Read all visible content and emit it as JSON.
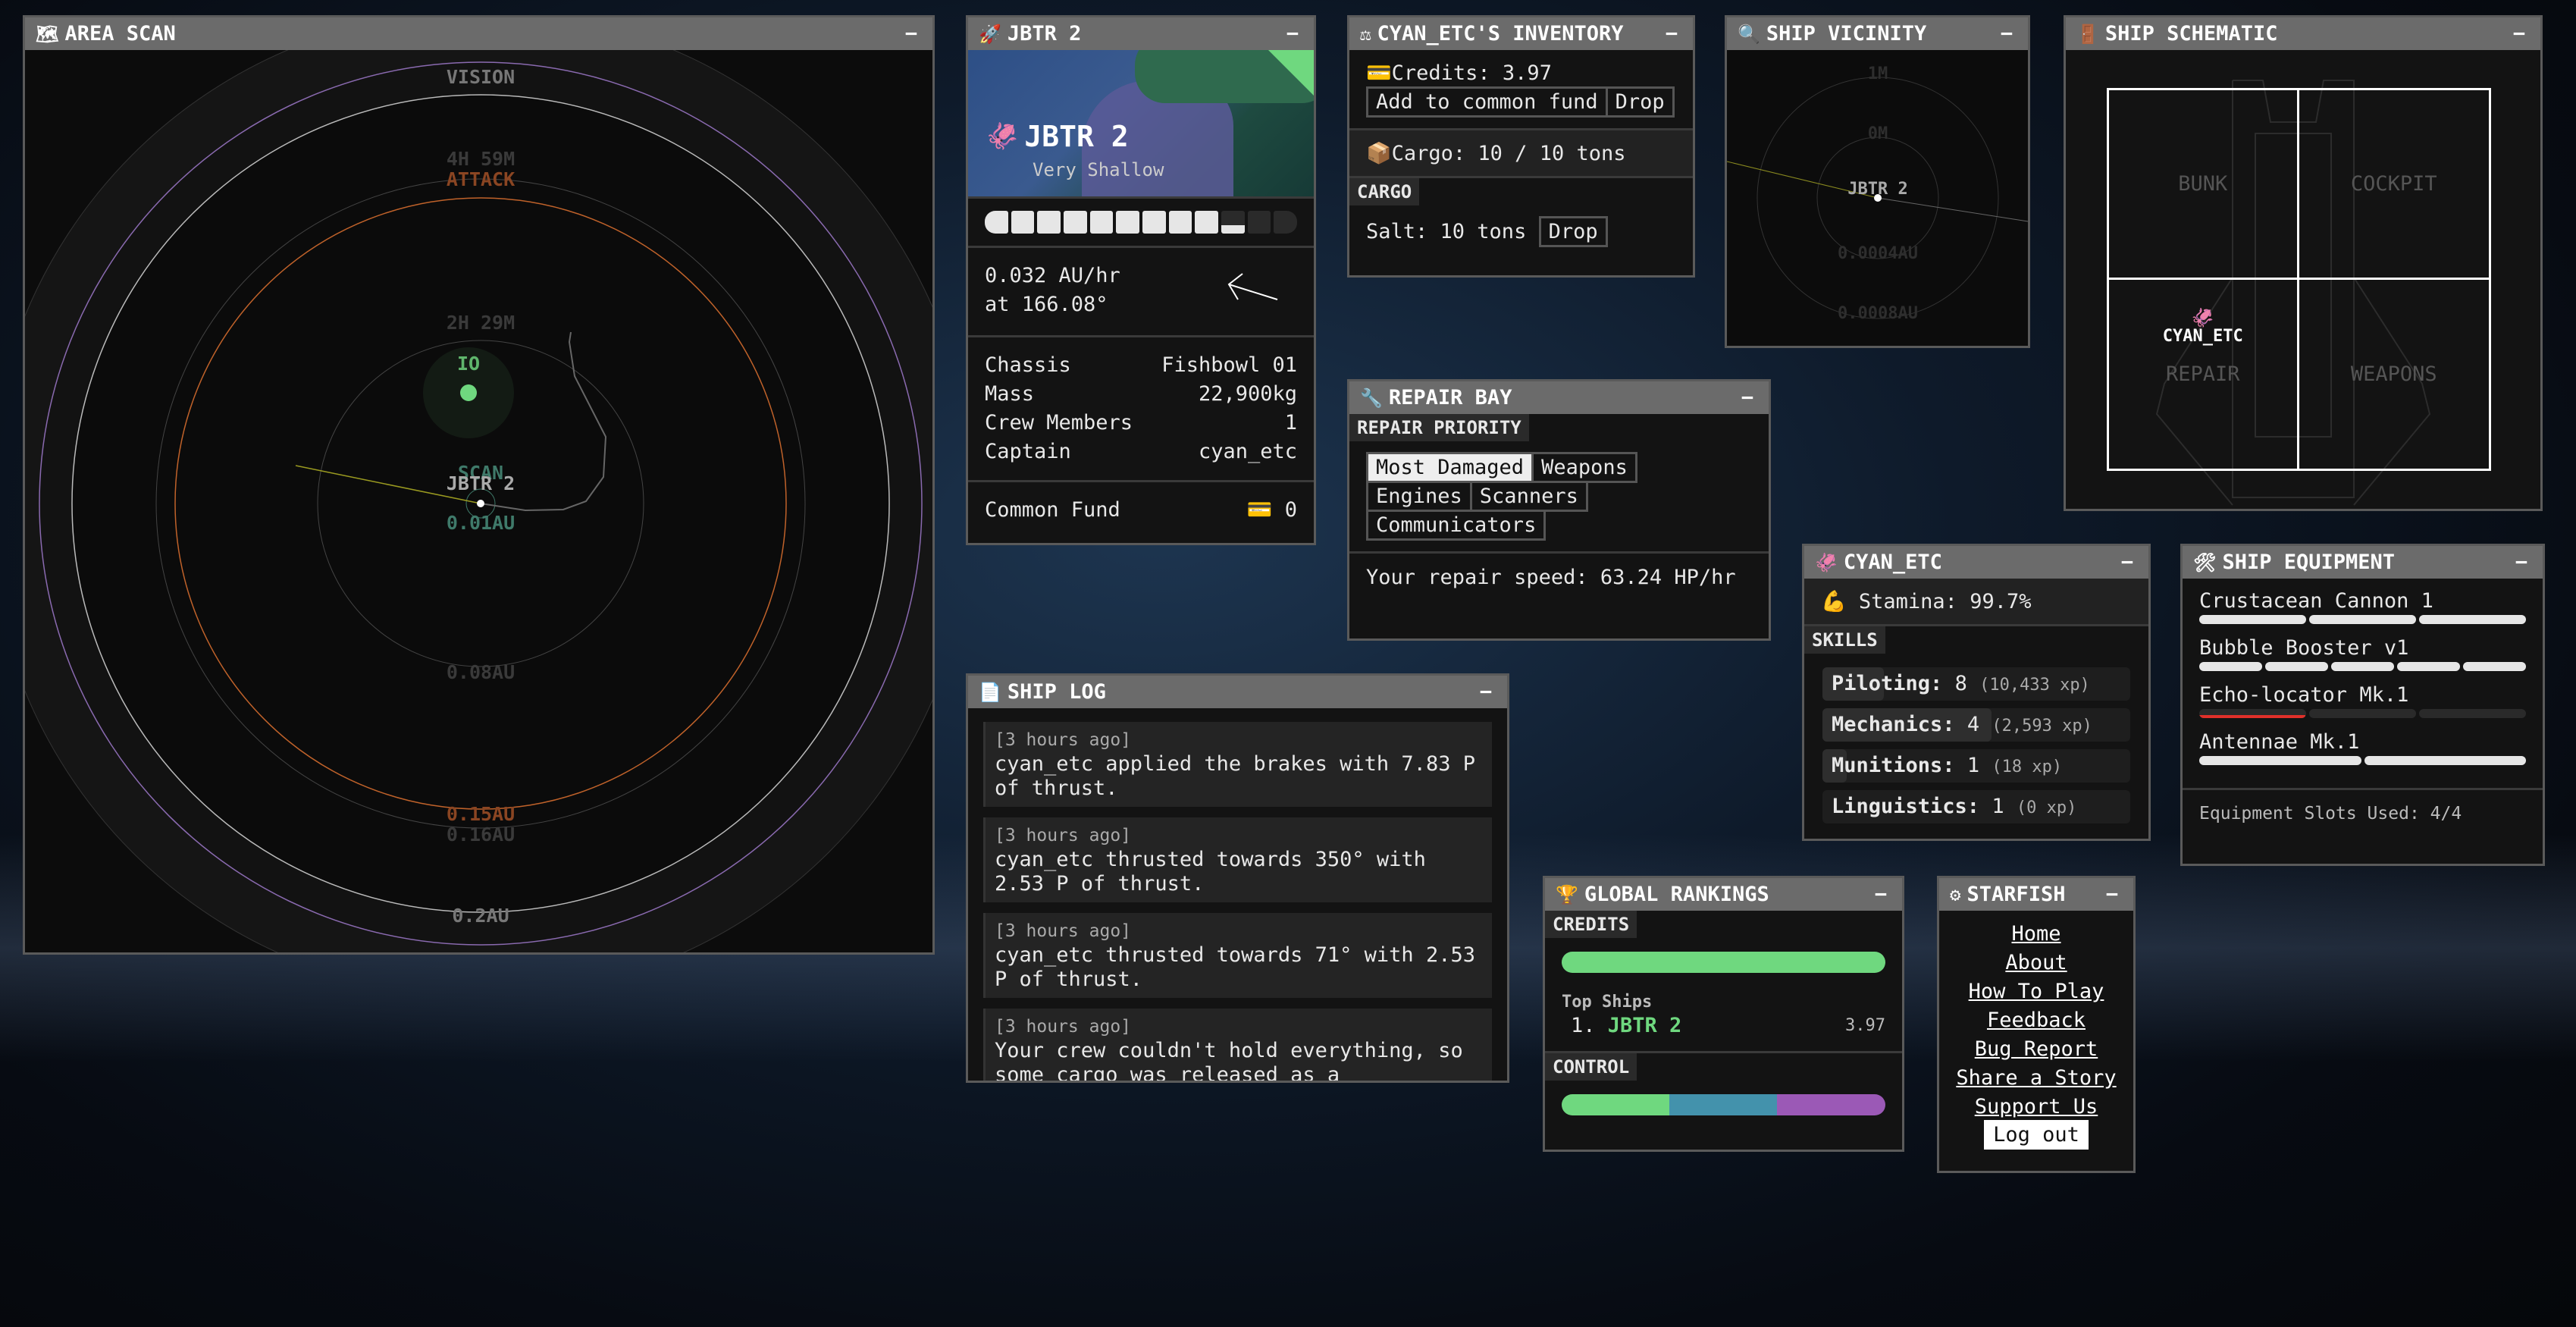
{
  "area_scan": {
    "title": "AREA SCAN",
    "icon": "map-icon",
    "labels": {
      "vision": "VISION",
      "eta_outer": "4H 59M",
      "attack": "ATTACK",
      "eta_inner": "2H 29M",
      "scan": "SCAN",
      "ship": "JBTR 2",
      "scan_range": "0.01AU",
      "r1": "0.08AU",
      "attack_range": "0.15AU",
      "r2": "0.16AU",
      "vision_range": "0.2AU",
      "planet": "IO"
    },
    "colors": {
      "attack": "#c0622a",
      "vision": "#cfcfcf",
      "planet": "#6fd87f",
      "scan": "#3f7a6a",
      "purple": "#8a6ab0"
    }
  },
  "ship": {
    "title": "JBTR 2",
    "icon": "rocket-icon",
    "name": "JBTR 2",
    "depth": "Very Shallow",
    "hull_fraction": 0.78,
    "hull_segments": 12,
    "speed": "0.032 AU/hr",
    "heading": "at 166.08°",
    "stats": [
      {
        "label": "Chassis",
        "value": "Fishbowl 01"
      },
      {
        "label": "Mass",
        "value": "22,900kg"
      },
      {
        "label": "Crew Members",
        "value": "1"
      },
      {
        "label": "Captain",
        "value": "cyan_etc"
      }
    ],
    "common_fund_label": "Common Fund",
    "common_fund": "0"
  },
  "inventory": {
    "title": "CYAN_ETC'S INVENTORY",
    "icon": "scale-icon",
    "credits": "Credits: 3.97",
    "add_fund": "Add to common fund",
    "drop": "Drop",
    "cargo": "Cargo: 10 / 10 tons",
    "cargo_header": "CARGO",
    "items": [
      {
        "label": "Salt: 10 tons",
        "drop": "Drop"
      }
    ]
  },
  "vicinity": {
    "title": "SHIP VICINITY",
    "icon": "magnifier-icon",
    "labels": {
      "a": "1M",
      "b": "0M",
      "ship": "JBTR 2",
      "c": "0.0004AU",
      "d": "0.0008AU"
    }
  },
  "schematic": {
    "title": "SHIP SCHEMATIC",
    "icon": "door-icon",
    "rooms": [
      "BUNK",
      "COCKPIT",
      "REPAIR",
      "WEAPONS"
    ],
    "crew": "CYAN_ETC"
  },
  "repair": {
    "title": "REPAIR BAY",
    "icon": "wrench-icon",
    "header": "REPAIR PRIORITY",
    "options": [
      "Most Damaged",
      "Weapons",
      "Engines",
      "Scanners",
      "Communicators"
    ],
    "selected": "Most Damaged",
    "speed": "Your repair speed: 63.24 HP/hr"
  },
  "log": {
    "title": "SHIP LOG",
    "icon": "document-icon",
    "entries": [
      {
        "time": "[3 hours ago]",
        "text": "cyan_etc applied the brakes with 7.83 P of thrust."
      },
      {
        "time": "[3 hours ago]",
        "text": "cyan_etc thrusted towards 350° with 2.53 P of thrust."
      },
      {
        "time": "[3 hours ago]",
        "text": "cyan_etc thrusted towards 71° with 2.53 P of thrust."
      },
      {
        "time": "[3 hours ago]",
        "text": "Your crew couldn't hold everything, so some cargo was released as a"
      }
    ]
  },
  "crew": {
    "title": "CYAN_ETC",
    "icon": "squid-icon",
    "stamina": "Stamina: 99.7%",
    "skills_header": "SKILLS",
    "skills": [
      {
        "name": "Piloting:",
        "level": "8",
        "xp": "(10,433 xp)",
        "progress": 0.2
      },
      {
        "name": "Mechanics:",
        "level": "4",
        "xp": "(2,593 xp)",
        "progress": 0.55
      },
      {
        "name": "Munitions:",
        "level": "1",
        "xp": "(18 xp)",
        "progress": 0.08
      },
      {
        "name": "Linguistics:",
        "level": "1",
        "xp": "(0 xp)",
        "progress": 0
      }
    ]
  },
  "equipment": {
    "title": "SHIP EQUIPMENT",
    "icon": "tools-icon",
    "items": [
      {
        "name": "Crustacean Cannon 1",
        "segments": 3,
        "health": 1
      },
      {
        "name": "Bubble Booster v1",
        "segments": 5,
        "health": 1
      },
      {
        "name": "Echo-locator Mk.1",
        "segments": 3,
        "health": 0.33,
        "damaged": true
      },
      {
        "name": "Antennae Mk.1",
        "segments": 2,
        "health": 1
      }
    ],
    "slots": "Equipment Slots Used: 4/4"
  },
  "rankings": {
    "title": "GLOBAL RANKINGS",
    "icon": "trophy-icon",
    "credits_header": "CREDITS",
    "top_label": "Top Ships",
    "top": [
      {
        "rank": "1.",
        "name": "JBTR 2",
        "value": "3.97"
      }
    ],
    "control_header": "CONTROL",
    "control": [
      {
        "share": 0.333,
        "color": "#6fd87f"
      },
      {
        "share": 0.333,
        "color": "#4392ac"
      },
      {
        "share": 0.334,
        "color": "#9b59b6"
      }
    ]
  },
  "menu": {
    "title": "STARFISH",
    "icon": "gear-icon",
    "links": [
      "Home",
      "About",
      "How To Play",
      "Feedback",
      "Bug Report",
      "Share a Story",
      "Support Us"
    ],
    "logout": "Log out"
  }
}
